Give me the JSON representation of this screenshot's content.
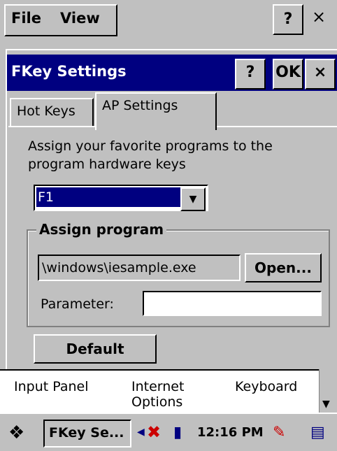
{
  "menubar": {
    "file": "File",
    "view": "View",
    "help": "?",
    "close": "×"
  },
  "dialog": {
    "title": "FKey Settings",
    "help": "?",
    "ok": "OK",
    "close": "×",
    "tabs": [
      {
        "label": "Hot Keys",
        "active": false
      },
      {
        "label": "AP Settings",
        "active": true
      }
    ],
    "description": "Assign your favorite programs to the program hardware keys",
    "key_select": {
      "value": "F1"
    },
    "assign_group": {
      "label": "Assign program",
      "path": "\\windows\\iesample.exe",
      "open_label": "Open...",
      "parameter_label": "Parameter:",
      "parameter_value": ""
    },
    "default_label": "Default"
  },
  "control_panel": {
    "items": [
      "Input Panel",
      "Internet Options",
      "Keyboard"
    ]
  },
  "taskbar": {
    "task_label": "FKey Se...",
    "clock": "12:16 PM"
  },
  "colors": {
    "titlebar": "#000080",
    "face": "#c0c0c0",
    "selection": "#000080"
  }
}
